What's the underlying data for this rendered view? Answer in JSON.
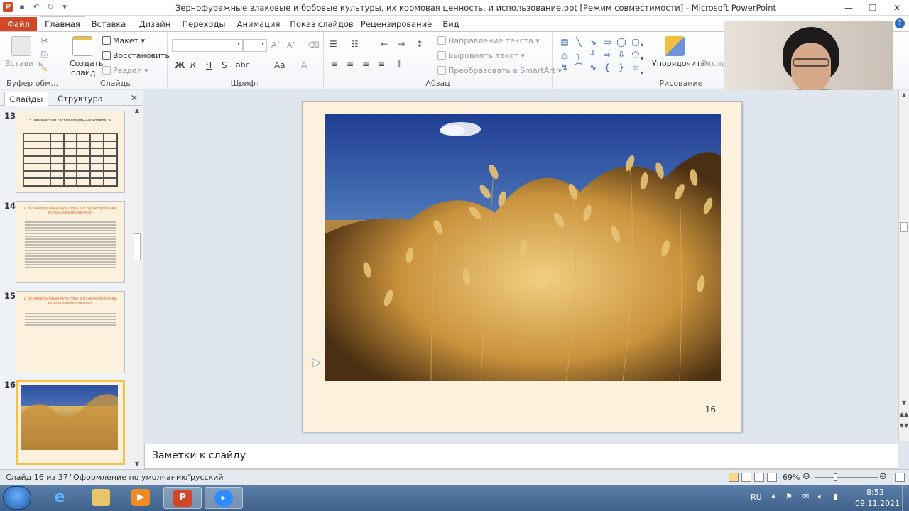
{
  "window": {
    "title": "Зернофуражные злаковые и бобовые культуры, их кормовая ценность,  и использование.ppt [Режим совместимости]  -  Microsoft PowerPoint"
  },
  "ribbon_tabs": [
    "Файл",
    "Главная",
    "Вставка",
    "Дизайн",
    "Переходы",
    "Анимация",
    "Показ слайдов",
    "Рецензирование",
    "Вид"
  ],
  "ribbon": {
    "clipboard": {
      "paste": "Вставить",
      "label": "Буфер обм..."
    },
    "slides": {
      "new_slide": "Создать",
      "new_slide2": "слайд",
      "layout": "Макет",
      "reset": "Восстановить",
      "section": "Раздел",
      "label": "Слайды"
    },
    "font": {
      "label": "Шрифт",
      "bold": "Ж",
      "italic": "К",
      "underline": "Ч",
      "strike": "S",
      "spacing": "abc",
      "case": "Аа",
      "color": "А"
    },
    "paragraph": {
      "text_direction": "Направление текста",
      "align_text": "Выровнять текст",
      "smartart": "Преобразовать в SmartArt",
      "label": "Абзац"
    },
    "drawing": {
      "arrange": "Упорядочить",
      "styles": "Экспр",
      "label": "Рисование"
    }
  },
  "left_panel": {
    "tabs": [
      "Слайды",
      "Структура"
    ],
    "thumbnails": [
      {
        "num": "13",
        "title": "3. Химический состав отдельных кормов, %"
      },
      {
        "num": "14",
        "title": "1. Зернофуражные культуры, их характеристика, использование на корм"
      },
      {
        "num": "15",
        "title": "1. Зернофуражные культуры, их характеристика, использование на корм"
      },
      {
        "num": "16",
        "title": ""
      }
    ]
  },
  "slide": {
    "number": "16"
  },
  "notes": {
    "placeholder": "Заметки к слайду"
  },
  "status": {
    "slide_counter": "Слайд 16 из 37",
    "theme": "\"Оформление по умолчанию\"",
    "language": "русский",
    "zoom": "69%"
  },
  "taskbar": {
    "lang": "RU",
    "time": "8:53",
    "date": "09.11.2021",
    "apps": [
      "internet-explorer",
      "file-explorer",
      "media-player",
      "powerpoint",
      "zoom"
    ]
  }
}
